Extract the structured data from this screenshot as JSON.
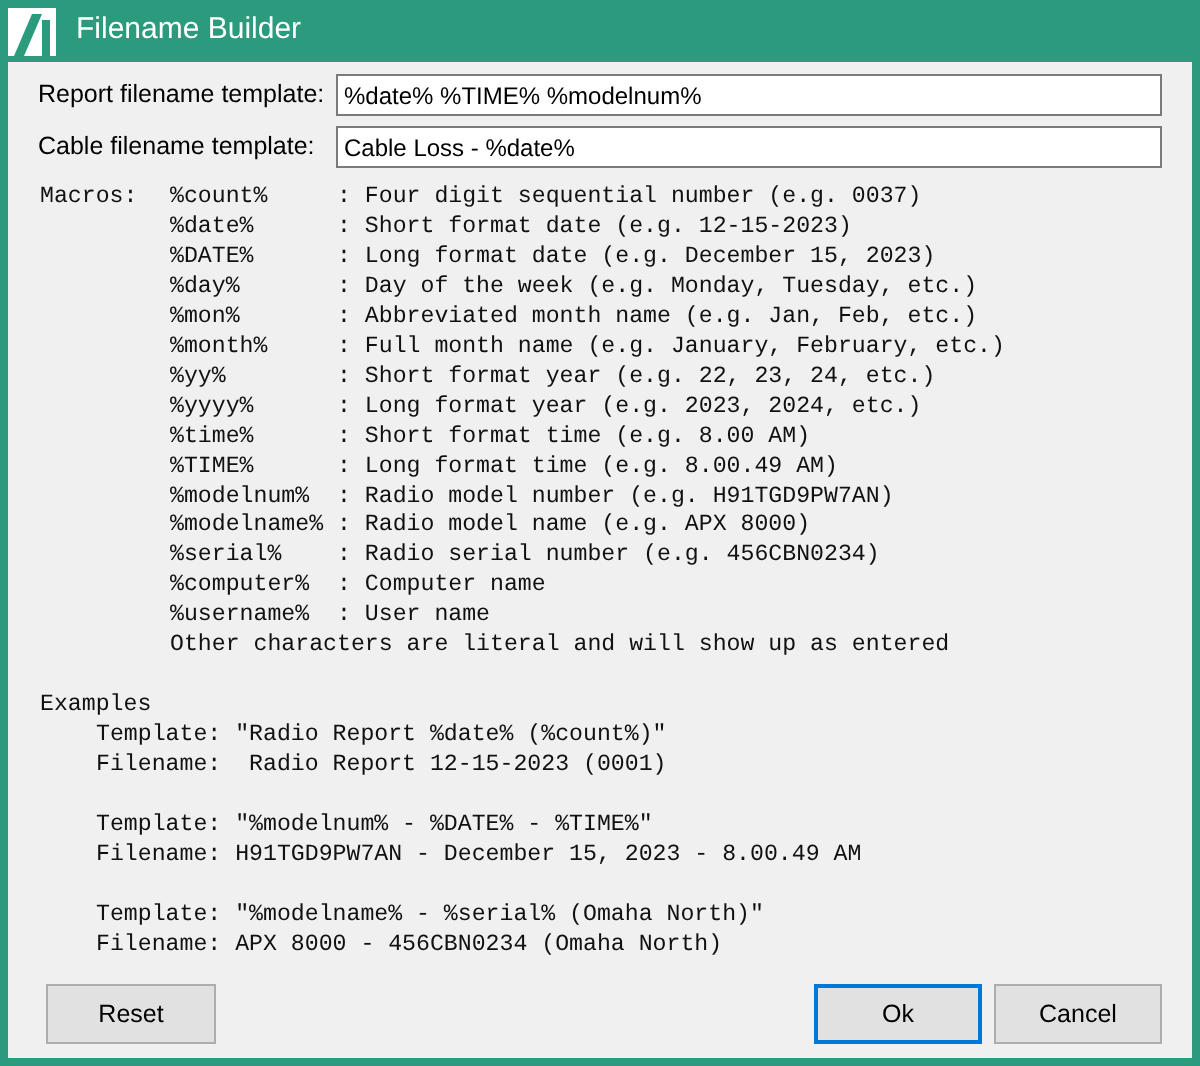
{
  "window": {
    "title": "Filename Builder"
  },
  "fields": [
    {
      "label": "Report filename template:",
      "value": "%date% %TIME% %modelnum%"
    },
    {
      "label": "Cable filename template:",
      "value": "Cable Loss - %date%"
    }
  ],
  "macros": {
    "label": "Macros:",
    "lines": [
      "%count%     : Four digit sequential number (e.g. 0037)",
      "%date%      : Short format date (e.g. 12-15-2023)",
      "%DATE%      : Long format date (e.g. December 15, 2023)",
      "%day%       : Day of the week (e.g. Monday, Tuesday, etc.)",
      "%mon%       : Abbreviated month name (e.g. Jan, Feb, etc.)",
      "%month%     : Full month name (e.g. January, February, etc.)",
      "%yy%        : Short format year (e.g. 22, 23, 24, etc.)",
      "%yyyy%      : Long format year (e.g. 2023, 2024, etc.)",
      "%time%      : Short format time (e.g. 8.00 AM)",
      "%TIME%      : Long format time (e.g. 8.00.49 AM)",
      "%modelnum%  : Radio model number (e.g. H91TGD9PW7AN)",
      "%modelname% : Radio model name (e.g. APX 8000)",
      "%serial%    : Radio serial number (e.g. 456CBN0234)",
      "%computer%  : Computer name",
      "%username%  : User name",
      "Other characters are literal and will show up as entered"
    ]
  },
  "examples": {
    "heading": "Examples",
    "items": [
      {
        "template": "Template: \"Radio Report %date% (%count%)\"",
        "filename": "Filename:  Radio Report 12-15-2023 (0001)"
      },
      {
        "template": "Template: \"%modelnum% - %DATE% - %TIME%\"",
        "filename": "Filename: H91TGD9PW7AN - December 15, 2023 - 8.00.49 AM"
      },
      {
        "template": "Template: \"%modelname% - %serial% (Omaha North)\"",
        "filename": "Filename: APX 8000 - 456CBN0234 (Omaha North)"
      }
    ]
  },
  "buttons": [
    {
      "label": "Reset",
      "default": false
    },
    {
      "label": "Ok",
      "default": true
    },
    {
      "label": "Cancel",
      "default": false
    }
  ]
}
